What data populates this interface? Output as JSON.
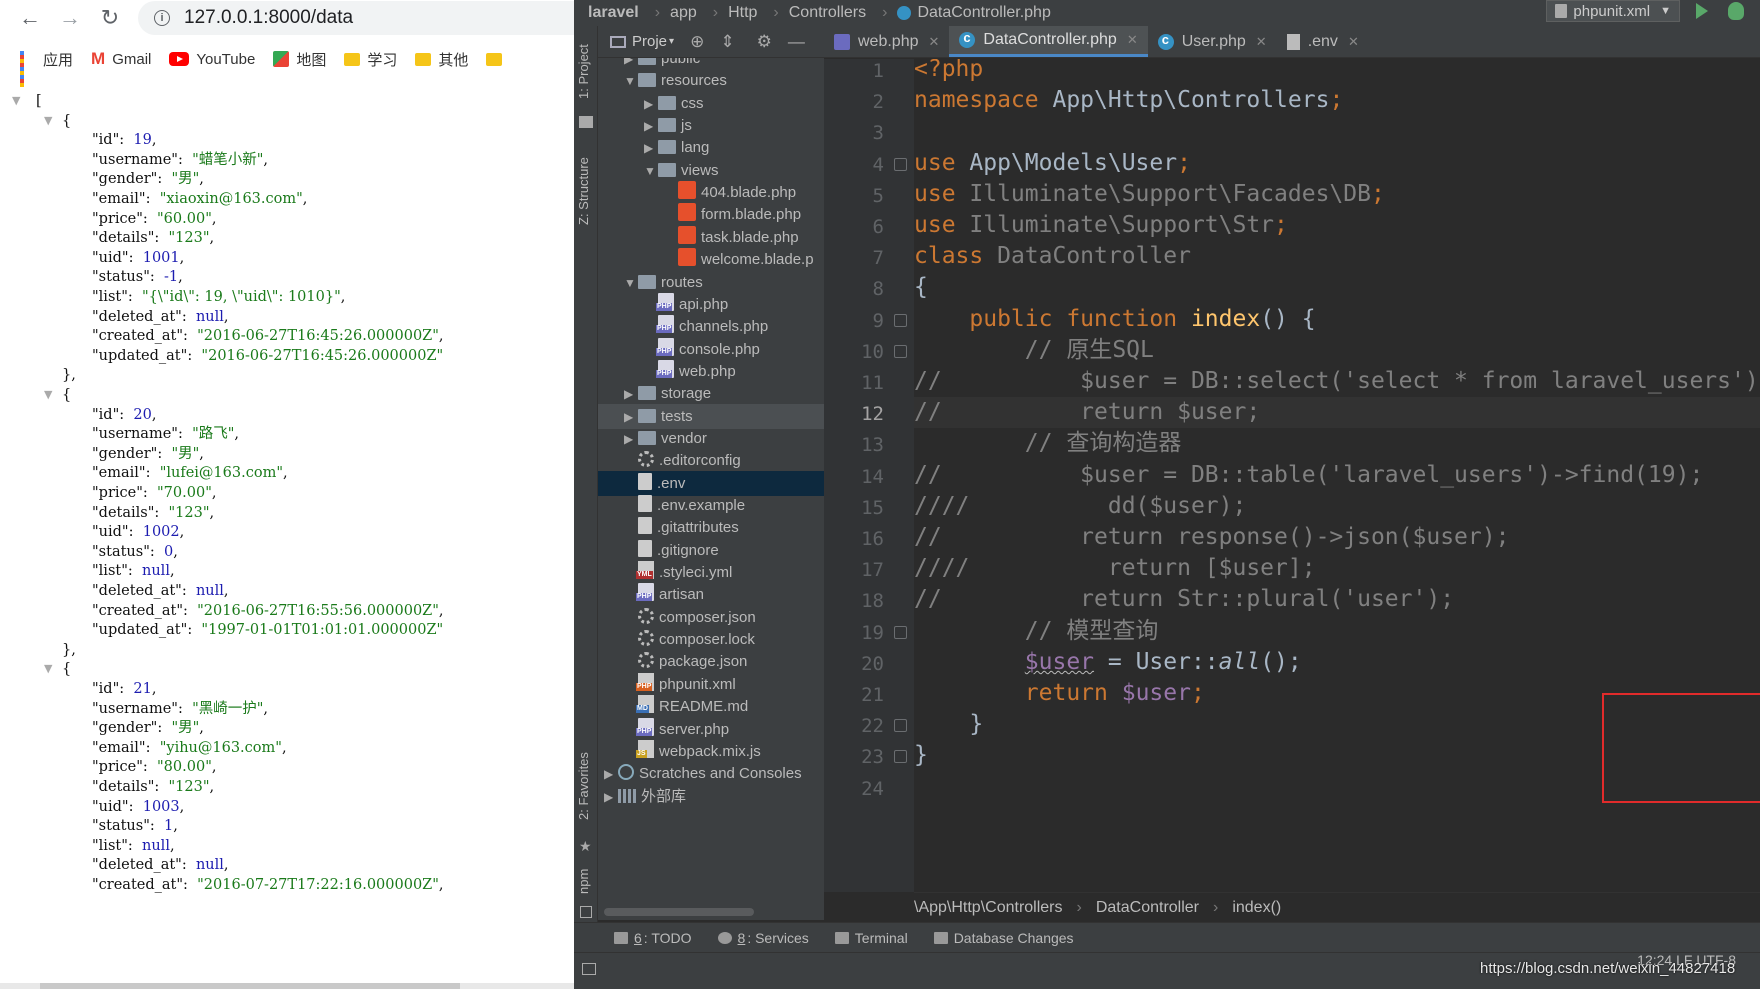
{
  "browser": {
    "back_icon": "arrow-left-icon",
    "forward_icon": "arrow-right-icon",
    "reload_icon": "reload-icon",
    "url": "127.0.0.1:8000/data",
    "bookmarks": [
      "应用",
      "Gmail",
      "YouTube",
      "地图",
      "学习",
      "其他"
    ],
    "json_lines": [
      {
        "t": "[",
        "indent": 0
      },
      {
        "t": "{",
        "indent": 1
      },
      {
        "k": "id",
        "v": "19",
        "vt": "n"
      },
      {
        "k": "username",
        "v": "\"蜡笔小新\"",
        "vt": "s"
      },
      {
        "k": "gender",
        "v": "\"男\"",
        "vt": "s"
      },
      {
        "k": "email",
        "v": "\"xiaoxin@163.com\"",
        "vt": "s"
      },
      {
        "k": "price",
        "v": "\"60.00\"",
        "vt": "s"
      },
      {
        "k": "details",
        "v": "\"123\"",
        "vt": "s"
      },
      {
        "k": "uid",
        "v": "1001",
        "vt": "n"
      },
      {
        "k": "status",
        "v": "-1",
        "vt": "n"
      },
      {
        "k": "list",
        "v": "\"{\\\"id\\\": 19, \\\"uid\\\": 1010}\"",
        "vt": "s"
      },
      {
        "k": "deleted_at",
        "v": "null",
        "vt": "n"
      },
      {
        "k": "created_at",
        "v": "\"2016-06-27T16:45:26.000000Z\"",
        "vt": "s"
      },
      {
        "k": "updated_at",
        "v": "\"2016-06-27T16:45:26.000000Z\"",
        "vt": "s",
        "last": true
      },
      {
        "t": "},",
        "indent": 1
      },
      {
        "t": "{",
        "indent": 1
      },
      {
        "k": "id",
        "v": "20",
        "vt": "n"
      },
      {
        "k": "username",
        "v": "\"路飞\"",
        "vt": "s"
      },
      {
        "k": "gender",
        "v": "\"男\"",
        "vt": "s"
      },
      {
        "k": "email",
        "v": "\"lufei@163.com\"",
        "vt": "s"
      },
      {
        "k": "price",
        "v": "\"70.00\"",
        "vt": "s"
      },
      {
        "k": "details",
        "v": "\"123\"",
        "vt": "s"
      },
      {
        "k": "uid",
        "v": "1002",
        "vt": "n"
      },
      {
        "k": "status",
        "v": "0",
        "vt": "n"
      },
      {
        "k": "list",
        "v": "null",
        "vt": "n"
      },
      {
        "k": "deleted_at",
        "v": "null",
        "vt": "n"
      },
      {
        "k": "created_at",
        "v": "\"2016-06-27T16:55:56.000000Z\"",
        "vt": "s"
      },
      {
        "k": "updated_at",
        "v": "\"1997-01-01T01:01:01.000000Z\"",
        "vt": "s",
        "last": true
      },
      {
        "t": "},",
        "indent": 1
      },
      {
        "t": "{",
        "indent": 1
      },
      {
        "k": "id",
        "v": "21",
        "vt": "n"
      },
      {
        "k": "username",
        "v": "\"黑崎一护\"",
        "vt": "s"
      },
      {
        "k": "gender",
        "v": "\"男\"",
        "vt": "s"
      },
      {
        "k": "email",
        "v": "\"yihu@163.com\"",
        "vt": "s"
      },
      {
        "k": "price",
        "v": "\"80.00\"",
        "vt": "s"
      },
      {
        "k": "details",
        "v": "\"123\"",
        "vt": "s"
      },
      {
        "k": "uid",
        "v": "1003",
        "vt": "n"
      },
      {
        "k": "status",
        "v": "1",
        "vt": "n"
      },
      {
        "k": "list",
        "v": "null",
        "vt": "n"
      },
      {
        "k": "deleted_at",
        "v": "null",
        "vt": "n"
      },
      {
        "k": "created_at",
        "v": "\"2016-07-27T17:22:16.000000Z\"",
        "vt": "s"
      }
    ]
  },
  "ide": {
    "breadcrumb": [
      "laravel",
      "app",
      "Http",
      "Controllers",
      "DataController.php"
    ],
    "run_config": "phpunit.xml",
    "left_tabs": [
      "1: Project",
      "Z: Structure",
      "2: Favorites",
      "npm"
    ],
    "project_label": "Proje",
    "tree": [
      {
        "label": "public",
        "lvl": 1,
        "arrow": "▶",
        "icon": "dir"
      },
      {
        "label": "resources",
        "lvl": 1,
        "arrow": "▼",
        "icon": "dir"
      },
      {
        "label": "css",
        "lvl": 2,
        "arrow": "▶",
        "icon": "dir"
      },
      {
        "label": "js",
        "lvl": 2,
        "arrow": "▶",
        "icon": "dir"
      },
      {
        "label": "lang",
        "lvl": 2,
        "arrow": "▶",
        "icon": "dir"
      },
      {
        "label": "views",
        "lvl": 2,
        "arrow": "▼",
        "icon": "dir"
      },
      {
        "label": "404.blade.php",
        "lvl": 3,
        "icon": "fblade"
      },
      {
        "label": "form.blade.php",
        "lvl": 3,
        "icon": "fblade"
      },
      {
        "label": "task.blade.php",
        "lvl": 3,
        "icon": "fblade"
      },
      {
        "label": "welcome.blade.p",
        "lvl": 3,
        "icon": "fblade"
      },
      {
        "label": "routes",
        "lvl": 1,
        "arrow": "▼",
        "icon": "dir"
      },
      {
        "label": "api.php",
        "lvl": 2,
        "icon": "fphp"
      },
      {
        "label": "channels.php",
        "lvl": 2,
        "icon": "fphp"
      },
      {
        "label": "console.php",
        "lvl": 2,
        "icon": "fphp"
      },
      {
        "label": "web.php",
        "lvl": 2,
        "icon": "fphp"
      },
      {
        "label": "storage",
        "lvl": 1,
        "arrow": "▶",
        "icon": "dir"
      },
      {
        "label": "tests",
        "lvl": 1,
        "arrow": "▶",
        "icon": "dir",
        "hov": true
      },
      {
        "label": "vendor",
        "lvl": 1,
        "arrow": "▶",
        "icon": "dir"
      },
      {
        "label": ".editorconfig",
        "lvl": 1,
        "icon": "fgear"
      },
      {
        "label": ".env",
        "lvl": 1,
        "icon": "ftxt",
        "sel": true
      },
      {
        "label": ".env.example",
        "lvl": 1,
        "icon": "ftxt"
      },
      {
        "label": ".gitattributes",
        "lvl": 1,
        "icon": "ftxt"
      },
      {
        "label": ".gitignore",
        "lvl": 1,
        "icon": "ftxt"
      },
      {
        "label": ".styleci.yml",
        "lvl": 1,
        "icon": "fyml"
      },
      {
        "label": "artisan",
        "lvl": 1,
        "icon": "fphp"
      },
      {
        "label": "composer.json",
        "lvl": 1,
        "icon": "fgear"
      },
      {
        "label": "composer.lock",
        "lvl": 1,
        "icon": "fgear"
      },
      {
        "label": "package.json",
        "lvl": 1,
        "icon": "fgear"
      },
      {
        "label": "phpunit.xml",
        "lvl": 1,
        "icon": "fxml"
      },
      {
        "label": "README.md",
        "lvl": 1,
        "icon": "fmd"
      },
      {
        "label": "server.php",
        "lvl": 1,
        "icon": "fphp"
      },
      {
        "label": "webpack.mix.js",
        "lvl": 1,
        "icon": "fjs"
      },
      {
        "label": "Scratches and Consoles",
        "lvl": 0,
        "arrow": "▶",
        "icon": "fsc"
      },
      {
        "label": "外部库",
        "lvl": 0,
        "arrow": "▶",
        "icon": "flib"
      }
    ],
    "tabs": [
      {
        "label": "web.php",
        "icon": "tphp"
      },
      {
        "label": "DataController.php",
        "icon": "tcs",
        "active": true
      },
      {
        "label": "User.php",
        "icon": "tcs"
      },
      {
        "label": ".env",
        "icon": "tenv"
      }
    ],
    "line_numbers": [
      "1",
      "2",
      "3",
      "4",
      "5",
      "6",
      "7",
      "8",
      "9",
      "10",
      "11",
      "12",
      "13",
      "14",
      "15",
      "16",
      "17",
      "18",
      "19",
      "20",
      "21",
      "22",
      "23",
      "24"
    ],
    "current_line": "12",
    "code_lines": [
      [
        [
          "kw",
          "<?php"
        ]
      ],
      [
        [
          "kw",
          "namespace "
        ],
        [
          "pl",
          "App\\Http\\Controllers"
        ],
        [
          "kw",
          ";"
        ]
      ],
      [],
      [
        [
          "kw",
          "use "
        ],
        [
          "pl",
          "App\\Models\\User"
        ],
        [
          "kw",
          ";"
        ]
      ],
      [
        [
          "kw",
          "use "
        ],
        [
          "cm",
          "Illuminate\\Support\\Facades\\DB"
        ],
        [
          "kw",
          ";"
        ]
      ],
      [
        [
          "kw",
          "use "
        ],
        [
          "cm",
          "Illuminate\\Support\\Str"
        ],
        [
          "kw",
          ";"
        ]
      ],
      [
        [
          "kw",
          "class "
        ],
        [
          "cm",
          "DataController"
        ]
      ],
      [
        [
          "pl",
          "{"
        ]
      ],
      [
        [
          "pl",
          "    "
        ],
        [
          "kw",
          "public function "
        ],
        [
          "fn",
          "index"
        ],
        [
          "pl",
          "() {"
        ]
      ],
      [
        [
          "cm",
          "        // 原生SQL"
        ]
      ],
      [
        [
          "cm",
          "//          $user = DB::select('select * from laravel_users')"
        ]
      ],
      [
        [
          "cm",
          "//          return $user;"
        ]
      ],
      [
        [
          "cm",
          "        // 查询构造器"
        ]
      ],
      [
        [
          "cm",
          "//          $user = DB::table('laravel_users')->find(19);"
        ]
      ],
      [
        [
          "cm",
          "////          dd($user);"
        ]
      ],
      [
        [
          "cm",
          "//          return response()->json($user);"
        ]
      ],
      [
        [
          "cm",
          "////          return [$user];"
        ]
      ],
      [
        [
          "cm",
          "//          return Str::plural('user');"
        ]
      ],
      [
        [
          "cm",
          "        // 模型查询"
        ]
      ],
      [
        [
          "pl",
          "        "
        ],
        [
          "vru",
          "$user"
        ],
        [
          "pl",
          " = User::"
        ],
        [
          "it",
          "all"
        ],
        [
          "pl",
          "();"
        ]
      ],
      [
        [
          "pl",
          "        "
        ],
        [
          "kw",
          "return "
        ],
        [
          "vr",
          "$user"
        ],
        [
          "kw",
          ";"
        ]
      ],
      [
        [
          "pl",
          "    }"
        ]
      ],
      [
        [
          "pl",
          "}"
        ]
      ],
      []
    ],
    "crumbbar": [
      "\\App\\Http\\Controllers",
      "DataController",
      "index()"
    ],
    "bottom_tabs": [
      {
        "u": "6",
        "label": ": TODO"
      },
      {
        "u": "8",
        "label": ": Services"
      },
      {
        "u": "",
        "label": "Terminal"
      },
      {
        "u": "",
        "label": "Database Changes"
      }
    ],
    "status_pos": "12:24   LF   UTF-8",
    "watermark": "https://blog.csdn.net/weixin_44827418"
  }
}
